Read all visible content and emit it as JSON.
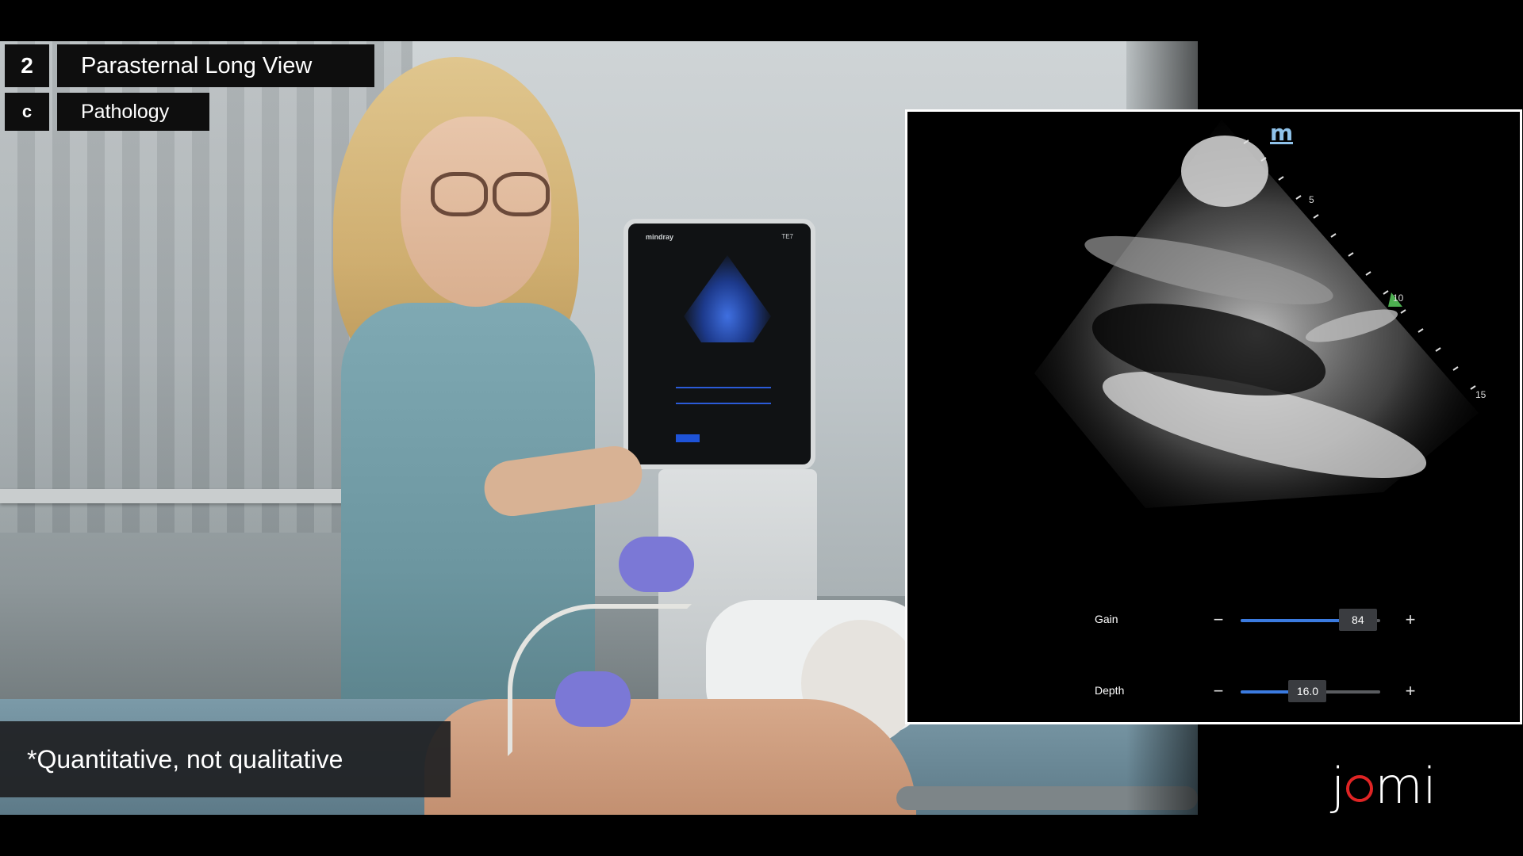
{
  "video": {
    "step_number": "2",
    "step_title": "Parasternal Long View",
    "section_letter": "c",
    "section_title": "Pathology",
    "caption": "*Quantitative, not qualitative"
  },
  "background_device": {
    "brand": "mindray",
    "model": "TE7"
  },
  "ultrasound": {
    "logo": "m",
    "depth_markers": [
      "5",
      "10",
      "15"
    ],
    "controls": [
      {
        "label": "Gain",
        "value": "84",
        "level_percent": 84
      },
      {
        "label": "Depth",
        "value": "16.0",
        "level_percent": 48
      }
    ],
    "minus_symbol": "−",
    "plus_symbol": "+"
  },
  "branding": {
    "logo_j": "j",
    "logo_mi": "mi",
    "accent_color": "#e02424"
  }
}
